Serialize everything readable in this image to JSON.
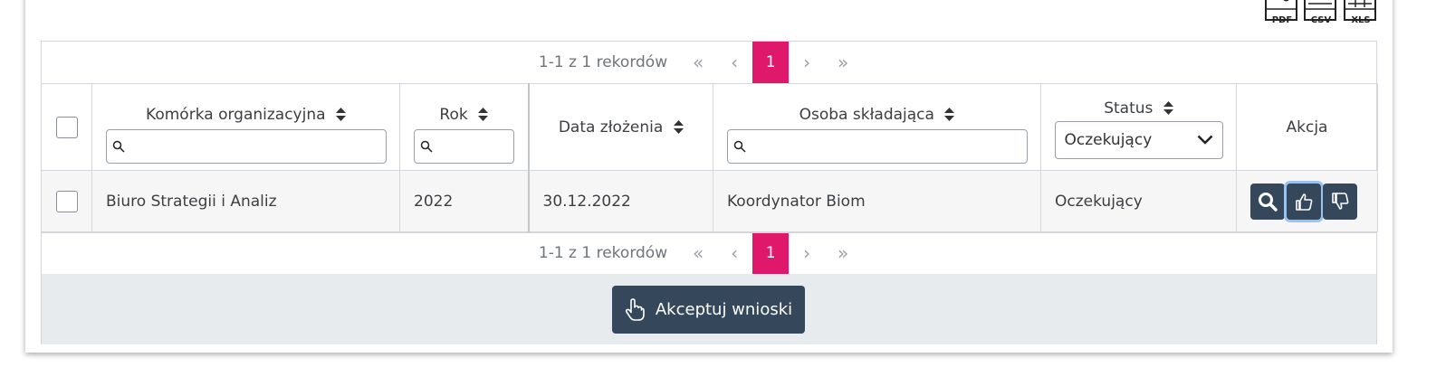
{
  "exports": [
    {
      "label": "PDF",
      "icon": "pdf-icon"
    },
    {
      "label": "CSV",
      "icon": "csv-icon"
    },
    {
      "label": "XLS",
      "icon": "xls-icon"
    }
  ],
  "pager": {
    "info": "1-1 z 1 rekordów",
    "first": "«",
    "prev": "‹",
    "current": "1",
    "next": "›",
    "last": "»"
  },
  "columns": {
    "unit": "Komórka organizacyjna",
    "year": "Rok",
    "date": "Data złożenia",
    "person": "Osoba składająca",
    "status": "Status",
    "action": "Akcja"
  },
  "status_filter": {
    "selected": "Oczekujący"
  },
  "rows": [
    {
      "unit": "Biuro Strategii i Analiz",
      "year": "2022",
      "date": "30.12.2022",
      "person": "Koordynator Biom",
      "status": "Oczekujący"
    }
  ],
  "footer": {
    "accept_label": "Akceptuj wnioski"
  },
  "colors": {
    "accent": "#e0186b",
    "button": "#34475b"
  }
}
